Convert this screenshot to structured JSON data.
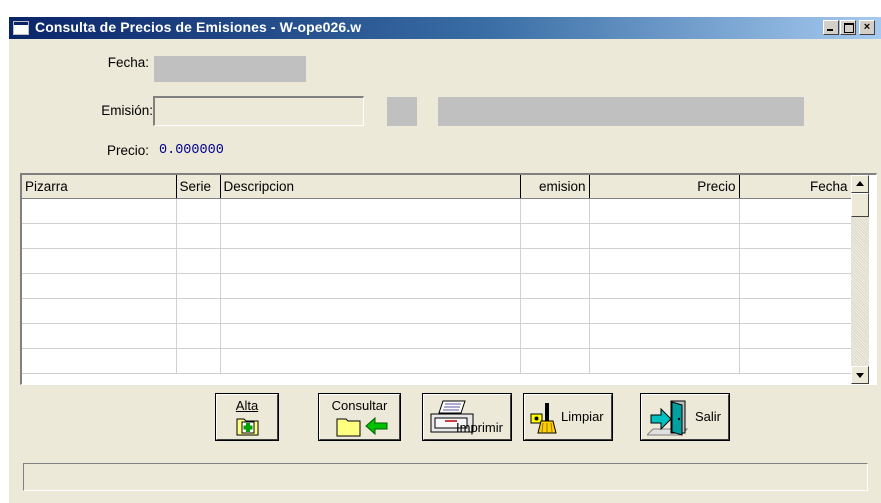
{
  "window": {
    "title": "Consulta de Precios de Emisiones - W-ope026.w",
    "controls": {
      "minimize": "_",
      "maximize": "□",
      "close": "×"
    }
  },
  "form": {
    "fecha_label": "Fecha:",
    "fecha_value": "",
    "emision_label": "Emisión:",
    "emision_value": "",
    "emision_code": "",
    "emision_desc": "",
    "precio_label": "Precio:",
    "precio_value": "0.000000"
  },
  "grid": {
    "columns": [
      "Pizarra",
      "Serie",
      "Descripcion",
      "emision",
      "Precio",
      "Fecha"
    ],
    "rows": [
      [
        "",
        "",
        "",
        "",
        "",
        ""
      ],
      [
        "",
        "",
        "",
        "",
        "",
        ""
      ],
      [
        "",
        "",
        "",
        "",
        "",
        ""
      ],
      [
        "",
        "",
        "",
        "",
        "",
        ""
      ],
      [
        "",
        "",
        "",
        "",
        "",
        ""
      ],
      [
        "",
        "",
        "",
        "",
        "",
        ""
      ],
      [
        "",
        "",
        "",
        "",
        "",
        ""
      ]
    ]
  },
  "buttons": {
    "alta": {
      "label": "Alta",
      "icon": "folder-add-icon"
    },
    "consultar": {
      "label": "Consultar",
      "icon": "folder-arrow-icon"
    },
    "imprimir": {
      "label": "Imprimir",
      "icon": "printer-icon"
    },
    "limpiar": {
      "label": "Limpiar",
      "icon": "broom-icon"
    },
    "salir": {
      "label": "Salir",
      "icon": "exit-door-icon"
    }
  },
  "status": {
    "text": ""
  },
  "colors": {
    "title_start": "#0a246a",
    "title_end": "#a6caf0",
    "face": "#ece9d8",
    "readonly": "#c0c0c0",
    "precio_text": "#00008b"
  }
}
